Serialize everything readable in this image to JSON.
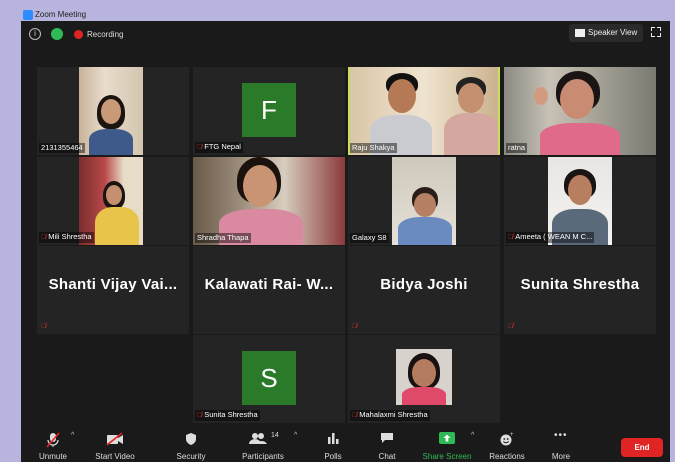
{
  "window": {
    "title": "Zoom Meeting"
  },
  "topbar": {
    "recording_label": "Recording",
    "view_label": "Speaker View"
  },
  "participants": [
    {
      "name": "2131355464",
      "muted": false,
      "video": true
    },
    {
      "name": "FTG Nepal",
      "muted": true,
      "video": false,
      "initial": "F"
    },
    {
      "name": "Raju Shakya",
      "muted": false,
      "video": true,
      "active": true
    },
    {
      "name": "ratna",
      "muted": false,
      "video": true
    },
    {
      "name": "Mili Shrestha",
      "muted": true,
      "video": true
    },
    {
      "name": "Shradha Thapa",
      "muted": false,
      "video": true
    },
    {
      "name": "Galaxy S8",
      "muted": false,
      "video": true
    },
    {
      "name": "Ameeta ( WEAN M C...",
      "muted": true,
      "video": true
    },
    {
      "name": "Shanti Vijay Vai...",
      "display": "Shanti  Vijay Vai...",
      "muted": true,
      "video": false
    },
    {
      "name": "Kalawati Rai- W...",
      "display": "Kalawati  Rai- W...",
      "muted": false,
      "video": false
    },
    {
      "name": "Bidya Joshi",
      "display": "Bidya Joshi",
      "muted": true,
      "video": false
    },
    {
      "name": "Sunita Shrestha",
      "display": "Sunita Shrestha",
      "muted": true,
      "video": false
    },
    {
      "name": "Sunita Shrestha",
      "muted": true,
      "video": false,
      "initial": "S"
    },
    {
      "name": "Mahalaxmi Shrestha",
      "muted": true,
      "video": true
    }
  ],
  "toolbar": {
    "unmute": "Unmute",
    "start_video": "Start Video",
    "security": "Security",
    "participants": "Participants",
    "participants_count": "14",
    "polls": "Polls",
    "chat": "Chat",
    "share_screen": "Share Screen",
    "reactions": "Reactions",
    "more": "More",
    "end": "End"
  },
  "colors": {
    "accent": "#2ebb55",
    "end": "#e02424",
    "active_speaker": "#c8e05a",
    "avatar_bg": "#2a7a2a"
  }
}
